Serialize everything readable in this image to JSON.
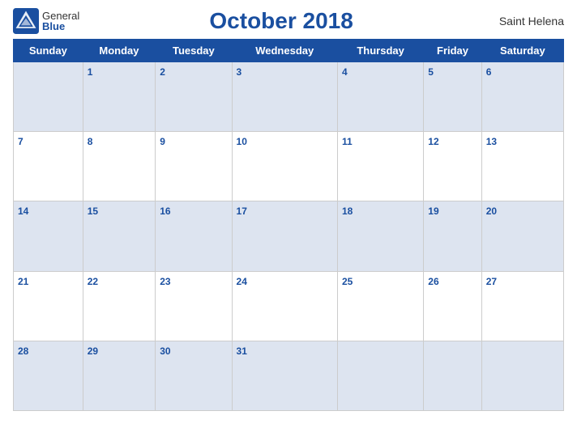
{
  "header": {
    "title": "October 2018",
    "location": "Saint Helena",
    "logo_general": "General",
    "logo_blue": "Blue"
  },
  "weekdays": [
    "Sunday",
    "Monday",
    "Tuesday",
    "Wednesday",
    "Thursday",
    "Friday",
    "Saturday"
  ],
  "weeks": [
    [
      null,
      1,
      2,
      3,
      4,
      5,
      6
    ],
    [
      7,
      8,
      9,
      10,
      11,
      12,
      13
    ],
    [
      14,
      15,
      16,
      17,
      18,
      19,
      20
    ],
    [
      21,
      22,
      23,
      24,
      25,
      26,
      27
    ],
    [
      28,
      29,
      30,
      31,
      null,
      null,
      null
    ]
  ]
}
